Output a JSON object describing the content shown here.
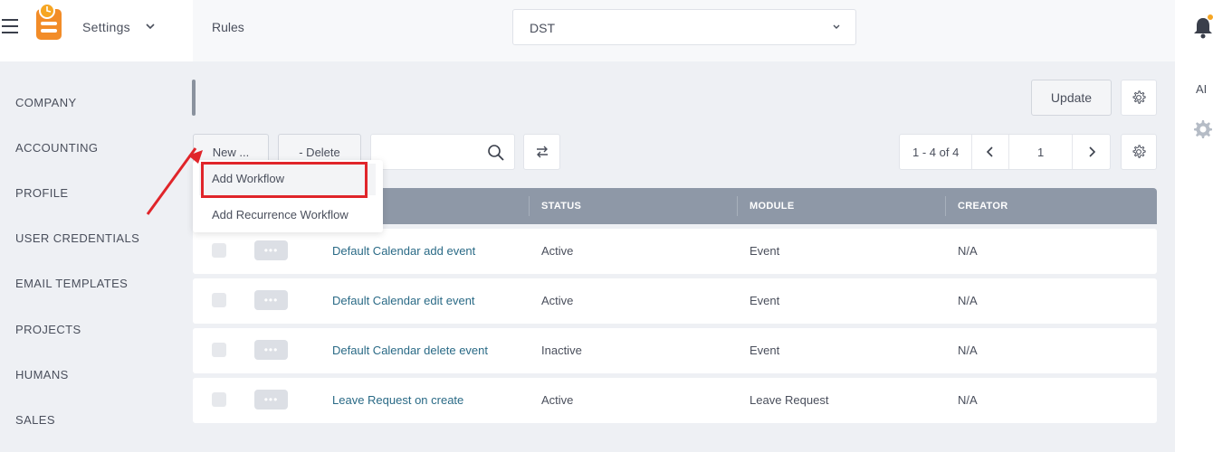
{
  "header": {
    "settings_label": "Settings",
    "breadcrumb": "Rules",
    "select_value": "DST",
    "ai_label": "AI"
  },
  "sidebar": {
    "items": [
      "COMPANY",
      "ACCOUNTING",
      "PROFILE",
      "USER CREDENTIALS",
      "EMAIL TEMPLATES",
      "PROJECTS",
      "HUMANS",
      "SALES"
    ]
  },
  "toolbar": {
    "update_label": "Update",
    "new_label": "New ...",
    "delete_label": "- Delete",
    "search_placeholder": ""
  },
  "pager": {
    "range": "1 - 4 of 4",
    "page": "1"
  },
  "dropdown": {
    "items": [
      "Add Workflow",
      "Add Recurrence Workflow"
    ]
  },
  "table": {
    "columns": [
      "STATUS",
      "MODULE",
      "CREATOR"
    ],
    "rows": [
      {
        "name": "Default Calendar add event",
        "status": "Active",
        "module": "Event",
        "creator": "N/A"
      },
      {
        "name": "Default Calendar edit event",
        "status": "Active",
        "module": "Event",
        "creator": "N/A"
      },
      {
        "name": "Default Calendar delete event",
        "status": "Inactive",
        "module": "Event",
        "creator": "N/A"
      },
      {
        "name": "Leave Request on create",
        "status": "Active",
        "module": "Leave Request",
        "creator": "N/A"
      }
    ]
  },
  "colors": {
    "accent": "#f28c28",
    "link": "#2a6a86",
    "header_row": "#8e98a7",
    "highlight": "#e0252a"
  }
}
